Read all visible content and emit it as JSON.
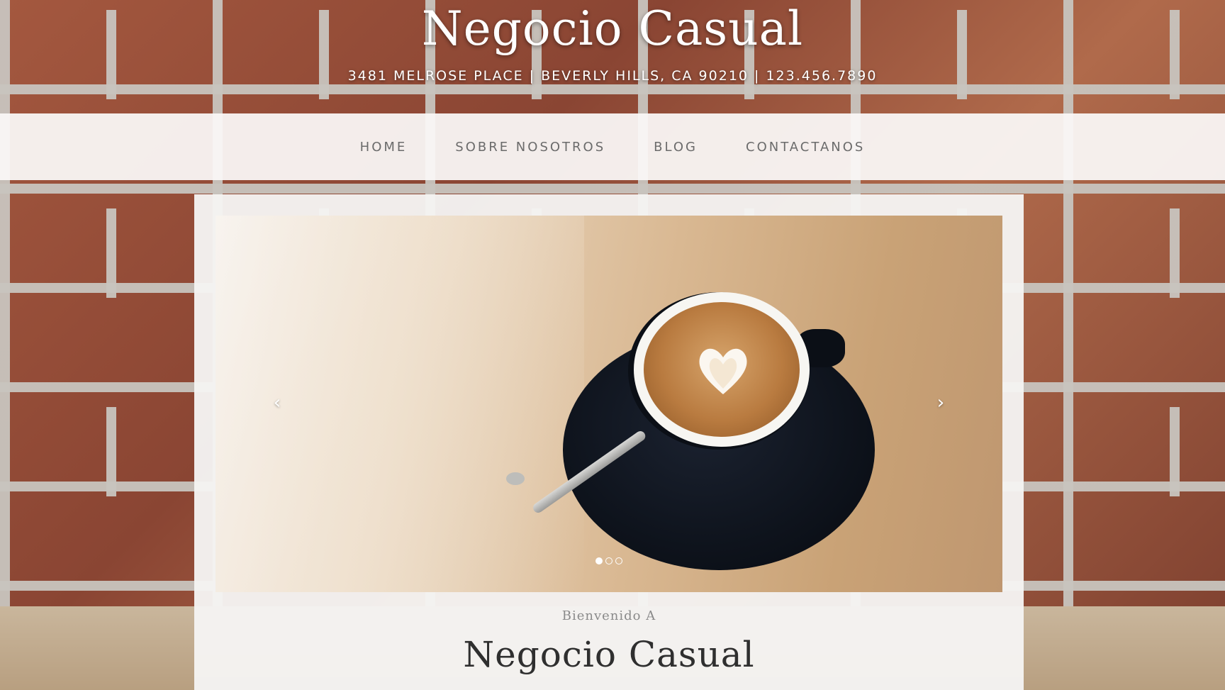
{
  "header": {
    "title": "Negocio Casual",
    "address": "3481 MELROSE PLACE | BEVERLY HILLS, CA 90210 | 123.456.7890"
  },
  "nav": {
    "items": [
      {
        "label": "HOME"
      },
      {
        "label": "SOBRE NOSOTROS"
      },
      {
        "label": "BLOG"
      },
      {
        "label": "CONTACTANOS"
      }
    ]
  },
  "carousel": {
    "prev_label": "‹",
    "next_label": "›",
    "slide_count": 3,
    "active_slide": 1
  },
  "welcome": {
    "intro": "Bienvenido A",
    "title": "Negocio Casual"
  },
  "colors": {
    "nav_text": "#6b6b6b",
    "title_text": "#ffffff",
    "welcome_title": "#2f2f2f"
  }
}
